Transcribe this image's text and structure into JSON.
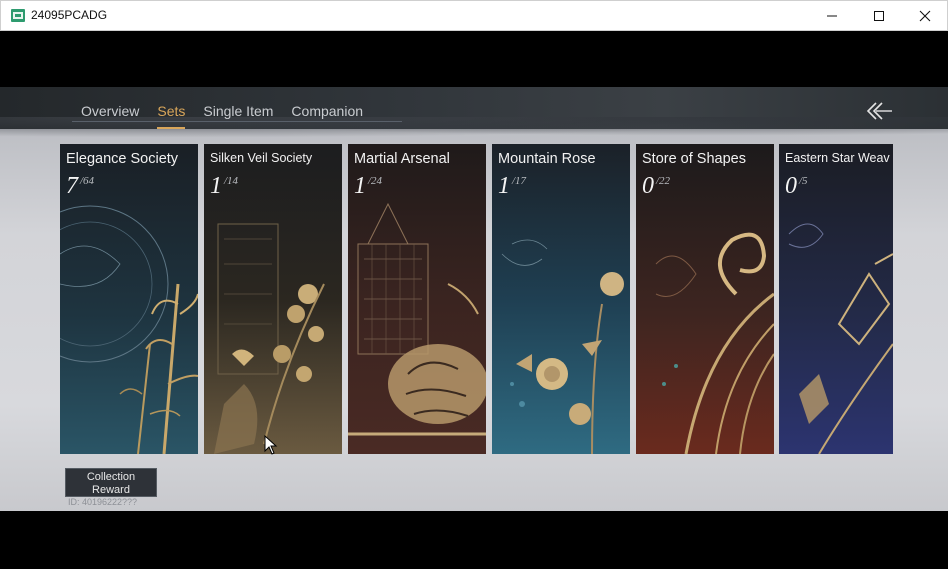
{
  "window": {
    "title": "24095PCADG",
    "icon": "app-icon",
    "controls": [
      "minimize-icon",
      "maximize-icon",
      "close-icon"
    ]
  },
  "nav": {
    "tabs": [
      {
        "label": "Overview",
        "active": false
      },
      {
        "label": "Sets",
        "active": true
      },
      {
        "label": "Single Item",
        "active": false
      },
      {
        "label": "Companion",
        "active": false
      }
    ],
    "back_icon": "back-arrow-icon",
    "accent_color": "#d9a65a"
  },
  "sets": [
    {
      "name": "Elegance Society",
      "count": "7",
      "total": "/64",
      "icon": "bamboo-moon-art"
    },
    {
      "name": "Silken Veil Society",
      "count": "1",
      "total": "/14",
      "icon": "bird-blossom-art"
    },
    {
      "name": "Martial Arsenal",
      "count": "1",
      "total": "/24",
      "icon": "tiger-tower-art"
    },
    {
      "name": "Mountain Rose",
      "count": "1",
      "total": "/17",
      "icon": "rose-flower-art"
    },
    {
      "name": "Store of Shapes",
      "count": "0",
      "total": "/22",
      "icon": "phoenix-wave-art"
    },
    {
      "name": "Eastern Star Weav",
      "count": "0",
      "total": "/5",
      "icon": "moth-cloud-art"
    }
  ],
  "footer": {
    "reward_line1": "Collection",
    "reward_line2": "Reward",
    "uid": "ID: 40196222???"
  }
}
